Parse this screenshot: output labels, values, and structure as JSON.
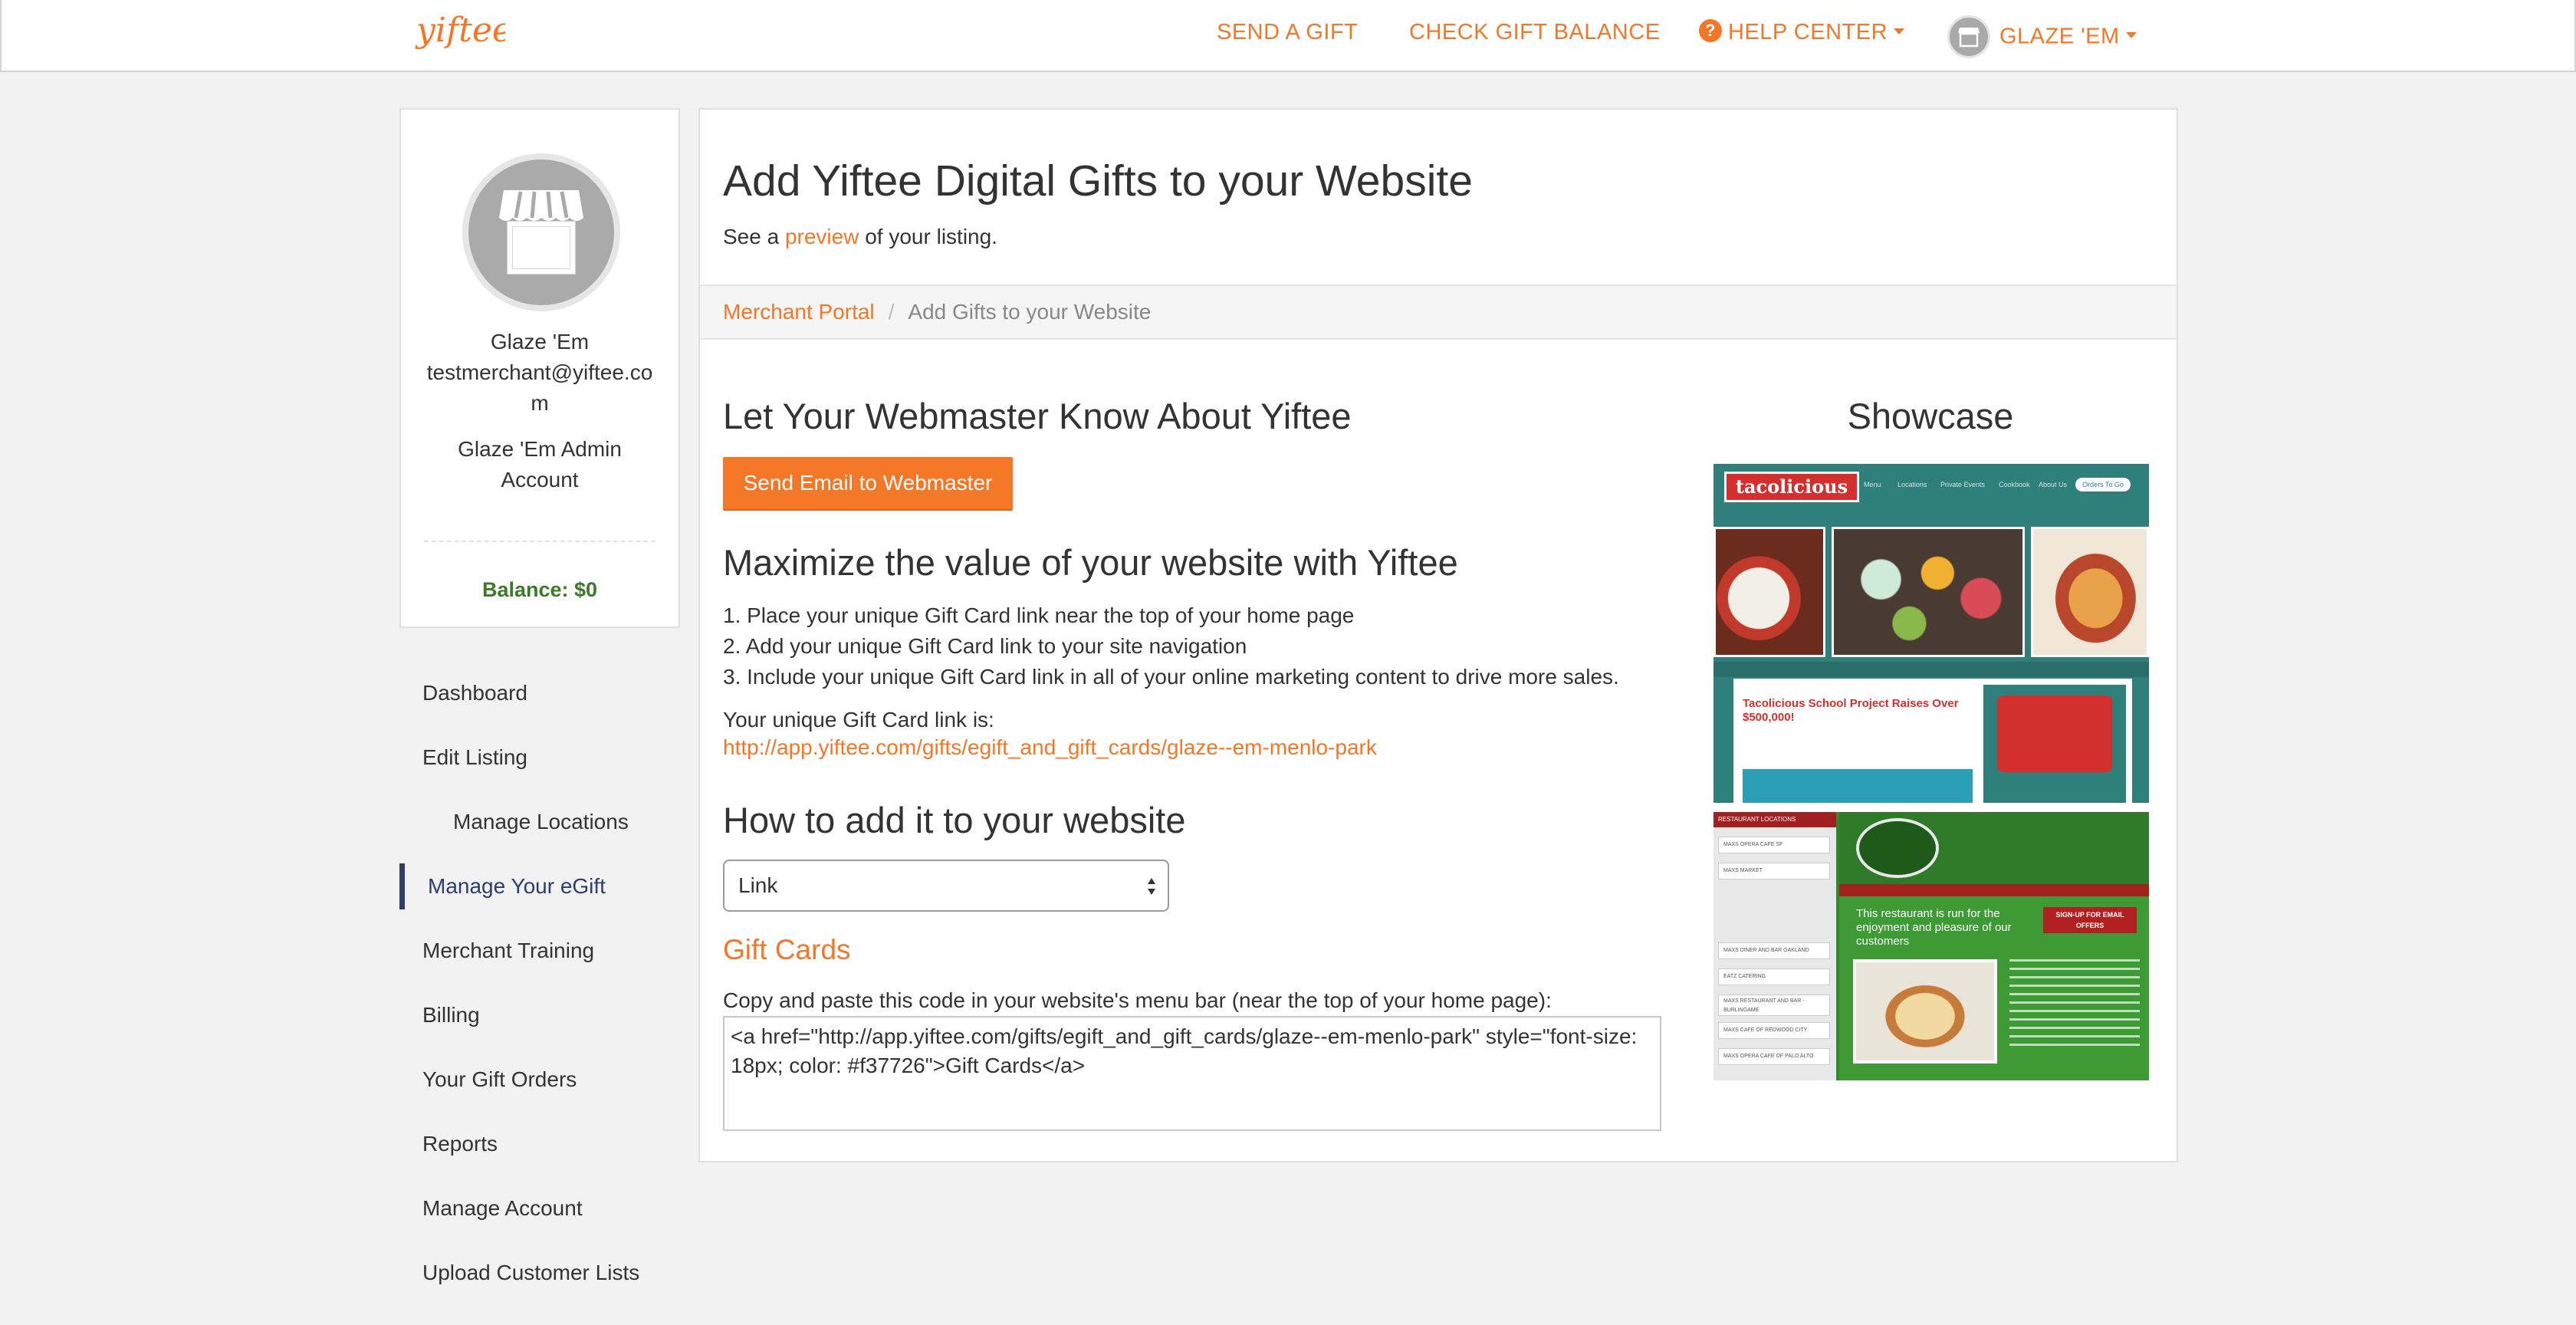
{
  "nav": {
    "logo_text": "yiftee",
    "send_gift": "SEND A GIFT",
    "check_balance": "CHECK GIFT BALANCE",
    "help_center": "HELP CENTER",
    "user_menu": "GLAZE 'EM"
  },
  "profile": {
    "name": "Glaze 'Em",
    "email": "testmerchant@yiftee.com",
    "account": "Glaze 'Em Admin Account",
    "balance": "Balance: $0"
  },
  "sidebar": {
    "items": [
      {
        "label": "Dashboard"
      },
      {
        "label": "Edit Listing"
      },
      {
        "label": "Manage Locations"
      },
      {
        "label": "Manage Your eGift"
      },
      {
        "label": "Merchant Training"
      },
      {
        "label": "Billing"
      },
      {
        "label": "Your Gift Orders"
      },
      {
        "label": "Reports"
      },
      {
        "label": "Manage Account"
      },
      {
        "label": "Upload Customer Lists"
      }
    ],
    "active": "Manage Your eGift"
  },
  "main": {
    "title": "Add Yiftee Digital Gifts to your Website",
    "subtitle_pre": "See a",
    "subtitle_link": "preview",
    "subtitle_post": "of your listing.",
    "breadcrumb": {
      "parent": "Merchant Portal",
      "separator": "/",
      "current": "Add Gifts to your Website"
    },
    "webmaster_heading": "Let Your Webmaster Know About Yiftee",
    "webmaster_button": "Send Email to Webmaster",
    "maximize_heading": "Maximize the value of your website with Yiftee",
    "steps": [
      "1. Place your unique Gift Card link near the top of your home page",
      "2. Add your unique Gift Card link to your site navigation",
      "3. Include your unique Gift Card link in all of your online marketing content to drive more sales."
    ],
    "link_label": "Your unique Gift Card link is:",
    "gift_link": "http://app.yiftee.com/gifts/egift_and_gift_cards/glaze--em-menlo-park",
    "howto_heading": "How to add it to your website",
    "select_value": "Link",
    "giftcards_heading": "Gift Cards",
    "copy_label": "Copy and paste this code in your website's menu bar (near the top of your home page):",
    "code": "<a href=\"http://app.yiftee.com/gifts/egift_and_gift_cards/glaze--em-menlo-park\" style=\"font-size: 18px; color: #f37726\">Gift Cards</a>"
  },
  "showcase": {
    "heading": "Showcase",
    "shot1": {
      "logo": "tacolicious",
      "nav": [
        "Menu",
        "Locations",
        "Private Events",
        "Cookbook",
        "About Us"
      ],
      "nav_button": "Orders To Go",
      "blog_title": "Tacolicious School Project Raises Over $500,000!"
    },
    "shot2": {
      "sidebar_header": "RESTAURANT LOCATIONS",
      "locations": [
        "MAXS OPERA CAFE SF",
        "MAXS MARKET",
        "MAXS DINER AND BAR OAKLAND",
        "EATZ CATERING",
        "MAXS RESTAURANT AND BAR - BURLINGAME",
        "MAXS CAFE OF REDWOOD CITY",
        "MAXS OPERA CAFE OF PALO ALTO"
      ],
      "tagline": "This restaurant is run for the enjoyment and pleasure of our customers",
      "signup": "SIGN-UP FOR EMAIL OFFERS"
    }
  },
  "colors": {
    "accent": "#f37726",
    "active_nav": "#2e3d6b",
    "balance": "#3c7a2a"
  }
}
